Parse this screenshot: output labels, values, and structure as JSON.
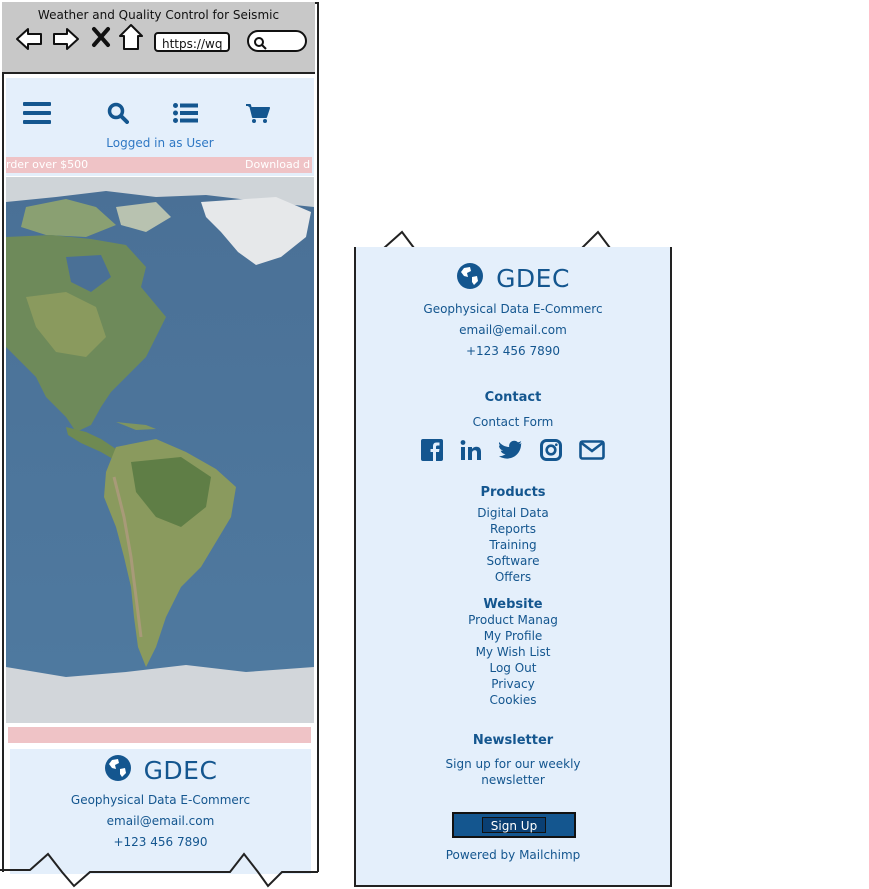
{
  "browser": {
    "title": "Weather and Quality Control for Seismic",
    "url": "https://wq",
    "icons": [
      "back-arrow-icon",
      "forward-arrow-icon",
      "close-icon",
      "home-icon",
      "search-icon"
    ]
  },
  "app_header": {
    "icons": [
      "menu-icon",
      "search-icon",
      "list-icon",
      "cart-icon"
    ],
    "logged_in": "Logged in as User"
  },
  "promo": {
    "left_text": "rder over $500",
    "right_text": "Download d"
  },
  "left_footer": {
    "brand": "GDEC",
    "company": "Geophysical Data E-Commerc",
    "email": "email@email.com",
    "phone": "+123 456 7890"
  },
  "right_footer": {
    "brand": "GDEC",
    "company": "Geophysical Data E-Commerc",
    "email": "email@email.com",
    "phone": "+123 456 7890",
    "contact": {
      "title": "Contact",
      "form_link": "Contact Form",
      "social_icons": [
        "facebook-icon",
        "linkedin-icon",
        "twitter-icon",
        "instagram-icon",
        "envelope-icon"
      ]
    },
    "products": {
      "title": "Products",
      "items": [
        "Digital Data",
        "Reports",
        "Training",
        "Software",
        "Offers"
      ]
    },
    "website": {
      "title": "Website",
      "items": [
        "Product Manag",
        "My Profile",
        "My Wish List",
        "Log Out",
        "Privacy",
        "Cookies"
      ]
    },
    "newsletter": {
      "title": "Newsletter",
      "text_line1": "Sign up for our weekly",
      "text_line2": "newsletter",
      "button": "Sign Up",
      "powered_by": "Powered by Mailchimp"
    }
  },
  "colors": {
    "panel_bg": "#e4effb",
    "brand_blue": "#14568f",
    "promo_pink": "#efc3c6",
    "browser_gray": "#c8c8c8"
  }
}
